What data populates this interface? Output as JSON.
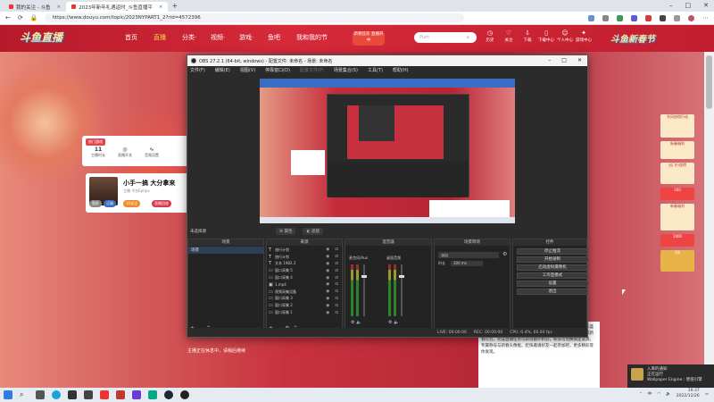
{
  "browser": {
    "tabs": [
      {
        "label": "我的关注 - 斗鱼",
        "active": false
      },
      {
        "label": "2023年新年礼遇返时_斗鱼直播平",
        "active": true
      }
    ],
    "url": "https://www.douyu.com/topic/2023NYPART1_2?rid=4572396",
    "new_tab": "+"
  },
  "site": {
    "logo": "斗鱼直播",
    "nav": [
      "首页",
      "直播",
      "分类·",
      "视频·",
      "游戏·",
      "鱼吧",
      "我和我的节"
    ],
    "promo": "新春狂欢 直播开中",
    "search_placeholder": "Pum",
    "header_icons": [
      "历史",
      "关注",
      "下载",
      "下载中心",
      "个人中心",
      "游戏中心"
    ],
    "right_logo": "斗鱼新春节",
    "room_category": "热门游戏",
    "room_stats": [
      {
        "value": "11",
        "label": "主播时长"
      },
      {
        "value": "",
        "label": "直播开关"
      },
      {
        "value": "",
        "label": "音频设置"
      }
    ],
    "streamer_name": "小手一搞 大分拿来",
    "streamer_meta": "主播 平台Ephpx",
    "streamer_buttons": [
      "鱼肝",
      "订阅",
      "10关注",
      "直播回放"
    ],
    "sidebar_items": [
      "东风启程行动",
      "新春福利",
      "出门行程得",
      "300",
      "新春福利",
      "1000",
      "3次"
    ],
    "right_panel_text": "您的大招新春红包等你来领取。新年新气象，斗鱼新春嘉年华盛大开幕，参与活动赢取丰厚奖励。活动期间每日登录即可领取新春礼包，完成直播任务可获得额外积分，积分可兑换限定道具、专属称号与新春头像框。赶快邀请好友一起参加吧，更多精彩等你发现。",
    "mid_text": "主播正在休息中，请稍后继续"
  },
  "obs": {
    "title": "OBS 27.2.1 (64-bit, windows) - 配置文件: 未命名 - 场景: 未命名",
    "menu": [
      "文件(F)",
      "编辑(E)",
      "视图(V)",
      "停靠窗口(D)",
      "配置文件(P)",
      "场景集合(S)",
      "工具(T)",
      "帮助(H)"
    ],
    "source_bar": {
      "label": "未选择源",
      "properties": "属性",
      "filters": "滤镜"
    },
    "docks": {
      "scenes": {
        "title": "场景",
        "items": [
          "场景"
        ]
      },
      "sources": {
        "title": "来源",
        "items": [
          {
            "icon": "T",
            "name": "旅行计划"
          },
          {
            "icon": "T",
            "name": "旅行计划"
          },
          {
            "icon": "T",
            "name": "文本 1982.3"
          },
          {
            "icon": "▭",
            "name": "窗口采集 5"
          },
          {
            "icon": "▭",
            "name": "窗口采集 4"
          },
          {
            "icon": "▣",
            "name": "1.mp4"
          },
          {
            "icon": "▭",
            "name": "视频采集设备"
          },
          {
            "icon": "▭",
            "name": "窗口采集 3"
          },
          {
            "icon": "▭",
            "name": "窗口采集 2"
          },
          {
            "icon": "▭",
            "name": "窗口采集 1"
          }
        ]
      },
      "mixer": {
        "title": "混音器",
        "channels": [
          "麦克风/Aux",
          "桌面音频"
        ]
      },
      "transitions": {
        "title": "场景转场",
        "type": "淡出",
        "duration_label": "时长",
        "duration": "300 ms"
      },
      "controls": {
        "title": "控件",
        "buttons": [
          "停止推流",
          "开始录制",
          "启动虚拟摄像机",
          "工作室模式",
          "设置",
          "退出"
        ]
      }
    },
    "status": {
      "live": "LIVE: 00:00:00",
      "rec": "REC: 00:00:00",
      "cpu": "CPU: 0.4%, 60.00 fps"
    }
  },
  "notification": {
    "title": "入库的通知",
    "line2": "正在运行",
    "app": "Wallpaper Engine : 壁纸引擎"
  },
  "clock": {
    "time": "19:37",
    "date": "2022/12/26"
  }
}
